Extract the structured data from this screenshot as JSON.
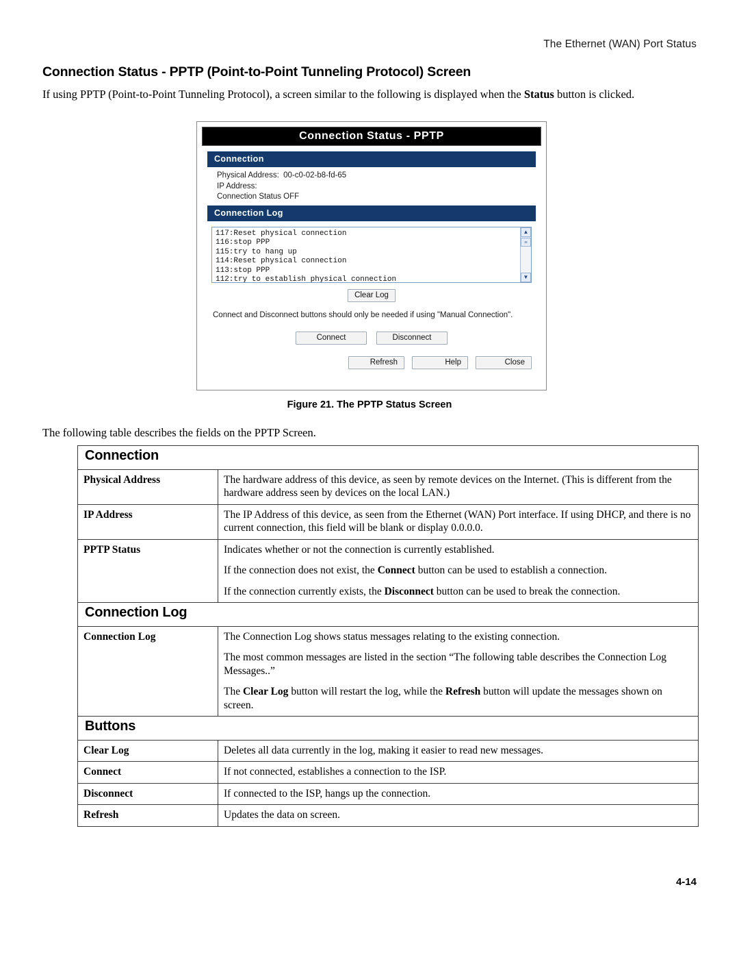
{
  "running_header": "The Ethernet (WAN) Port Status",
  "heading": "Connection Status - PPTP (Point-to-Point Tunneling Protocol) Screen",
  "intro_before": "If using PPTP (Point-to-Point Tunneling Protocol), a screen similar to the following is displayed when the ",
  "intro_bold": "Status",
  "intro_after": " button is clicked.",
  "figure": {
    "caption": "Figure 21. The PPTP Status Screen",
    "dialog": {
      "title": "Connection Status - PPTP",
      "connection_header": "Connection",
      "physical_address": "Physical Address:  00-c0-02-b8-fd-65",
      "ip_address": "IP Address:",
      "connection_status": "Connection Status OFF",
      "log_header": "Connection Log",
      "log_lines": [
        "117:Reset physical connection",
        "116:stop PPP",
        "115:try to hang up",
        "114:Reset physical connection",
        "113:stop PPP",
        "112:try to establish physical connection"
      ],
      "scroll_up_icon": "chevron-up-icon",
      "scroll_down_icon": "chevron-down-icon",
      "clear_log_label": "Clear Log",
      "note": "Connect and Disconnect buttons should only be needed if using \"Manual Connection\".",
      "connect_label": "Connect",
      "disconnect_label": "Disconnect",
      "refresh_label": "Refresh",
      "help_label": "Help",
      "close_label": "Close"
    }
  },
  "lead": "The following table describes the fields on the PPTP Screen.",
  "table": {
    "sections": [
      {
        "title": "Connection",
        "rows": [
          {
            "label": "Physical Address",
            "paras": [
              "The hardware address of this device, as seen by remote devices on the Internet. (This is different from the hardware address seen by devices on the local LAN.)"
            ]
          },
          {
            "label": "IP Address",
            "paras": [
              "The IP Address of this device, as seen from the Ethernet (WAN) Port interface. If using DHCP, and there is no current connection, this field will be blank or display 0.0.0.0."
            ]
          },
          {
            "label": "PPTP Status",
            "paras": [
              "Indicates whether or not the connection is currently established.",
              "If the connection does not exist, the <b>Connect</b> button can be used to establish a connection.",
              "If the connection currently exists, the <b>Disconnect</b> button can be used to break the connection."
            ]
          }
        ]
      },
      {
        "title": "Connection Log",
        "rows": [
          {
            "label": "Connection Log",
            "tall": true,
            "paras": [
              "The Connection Log shows status messages relating to the existing connection.",
              "The most common messages are listed in the section “The following table describes the Connection Log Messages..”",
              "The <b>Clear Log</b> button will restart the log, while the <b>Refresh</b> button will update the messages shown on screen."
            ]
          }
        ]
      },
      {
        "title": "Buttons",
        "rows": [
          {
            "label": "Clear Log",
            "paras": [
              "Deletes all data currently in the log, making it easier to read new messages."
            ]
          },
          {
            "label": "Connect",
            "paras": [
              "If not connected, establishes a connection to the ISP."
            ]
          },
          {
            "label": "Disconnect",
            "paras": [
              "If connected to the ISP, hangs up the connection."
            ]
          },
          {
            "label": "Refresh",
            "paras": [
              "Updates the data on screen."
            ]
          }
        ]
      }
    ]
  },
  "page_number": "4-14"
}
